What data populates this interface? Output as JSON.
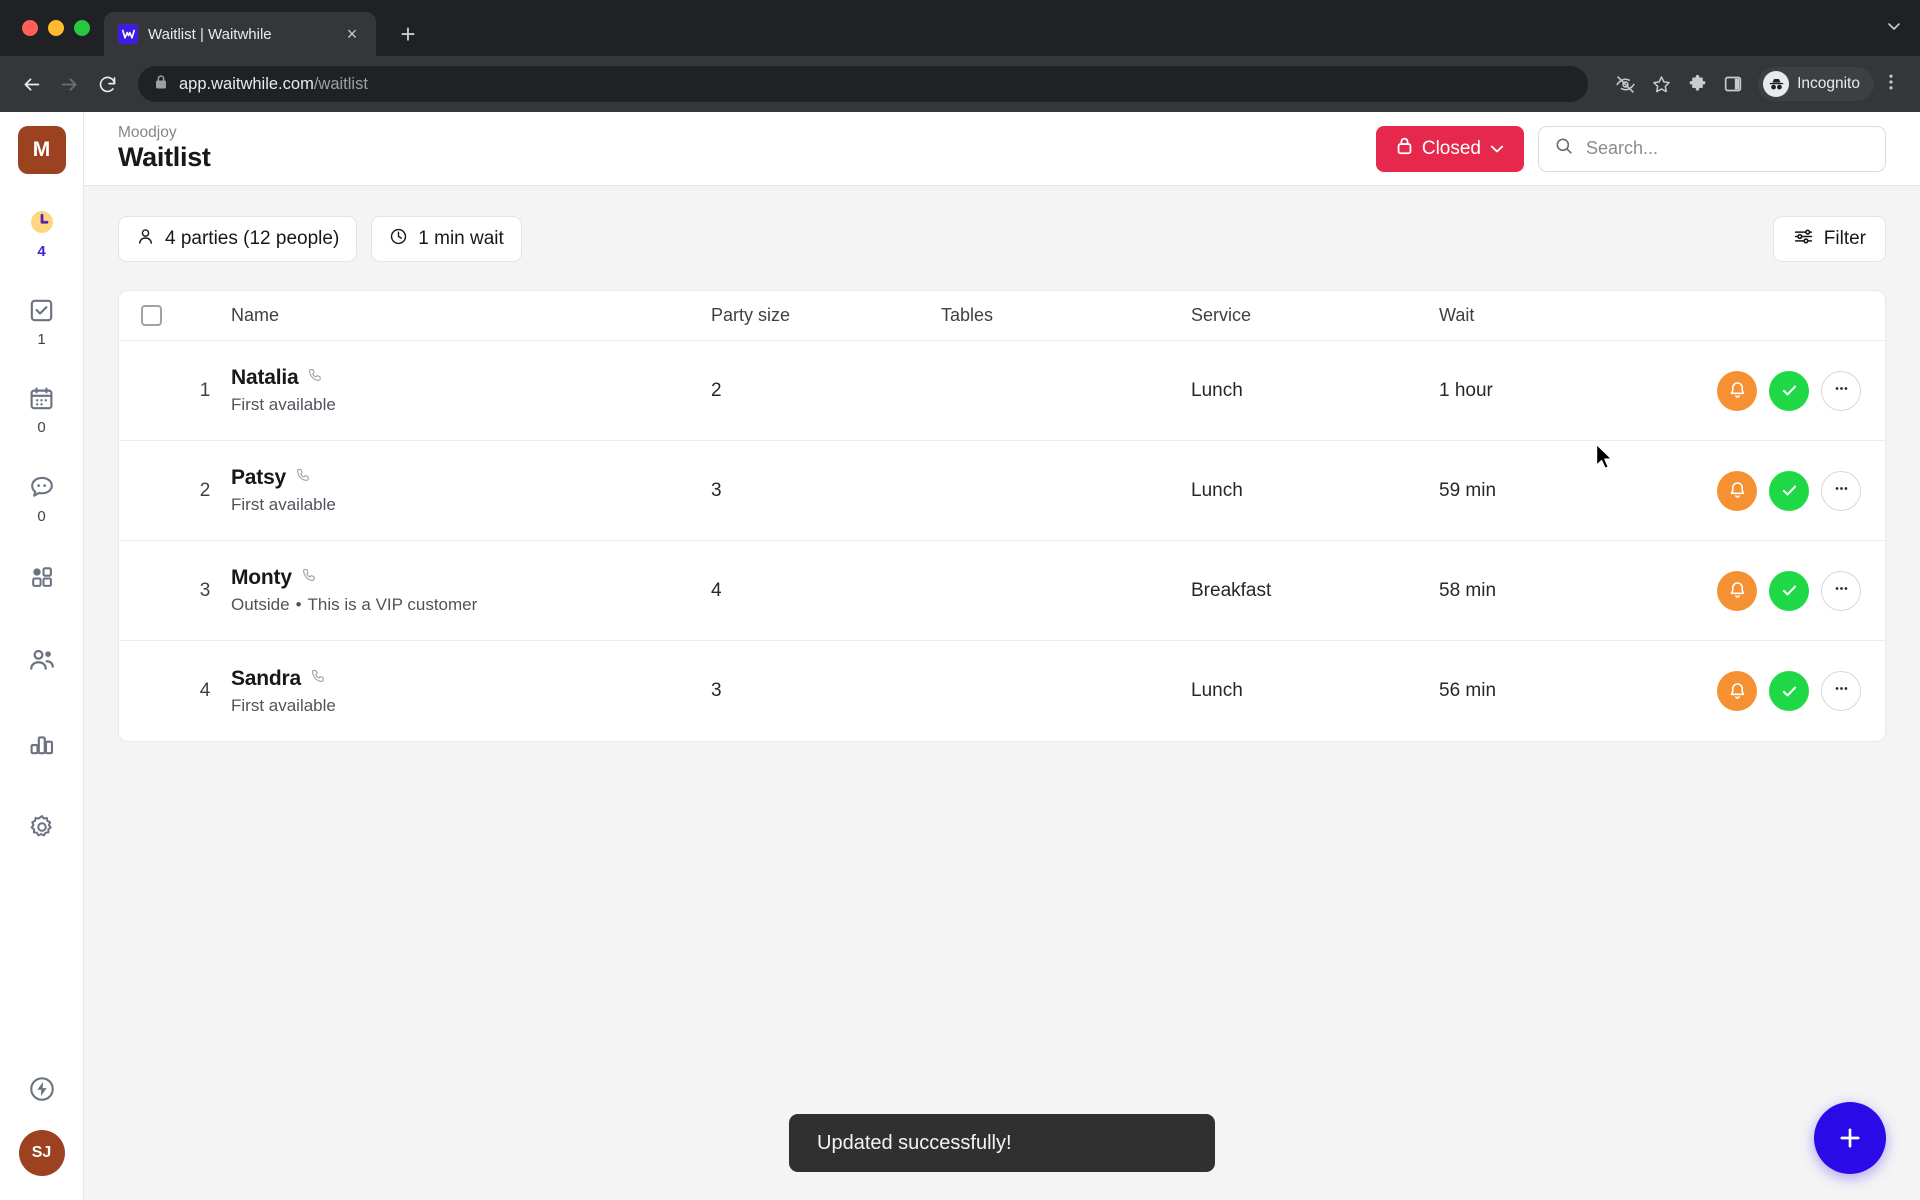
{
  "browser": {
    "tab": {
      "title": "Waitlist | Waitwhile",
      "favicon_letter": "W"
    },
    "new_tab_label": "+",
    "close_label": "×",
    "tab_list_caret": "⌵",
    "url_host": "app.waitwhile.com",
    "url_path": "/waitlist",
    "profile_label": "Incognito",
    "icons": {
      "back": "back-arrow-icon",
      "forward": "forward-arrow-icon",
      "reload": "reload-icon",
      "lock": "lock-icon",
      "tracking_protection": "eye-off-icon",
      "bookmark": "star-icon",
      "extensions": "puzzle-icon",
      "side_panel": "side-panel-icon",
      "menu": "kebab-menu-icon"
    }
  },
  "sidebar": {
    "org_initial": "M",
    "items": [
      {
        "name": "waitlist",
        "icon": "clock-icon",
        "count": "4",
        "active": true
      },
      {
        "name": "serving",
        "icon": "checkbox-icon",
        "count": "1",
        "active": false
      },
      {
        "name": "bookings",
        "icon": "calendar-icon",
        "count": "0",
        "active": false
      },
      {
        "name": "messages",
        "icon": "chat-bubble-icon",
        "count": "0",
        "active": false
      },
      {
        "name": "apps",
        "icon": "grid-icon",
        "count": "",
        "active": false
      },
      {
        "name": "customers",
        "icon": "people-icon",
        "count": "",
        "active": false
      },
      {
        "name": "analytics",
        "icon": "bar-chart-icon",
        "count": "",
        "active": false
      },
      {
        "name": "settings",
        "icon": "gear-icon",
        "count": "",
        "active": false
      }
    ],
    "bottom": {
      "power_icon": "lightning-circle-icon",
      "user_initials": "SJ"
    },
    "accent_color": "#4521d6",
    "brand_color": "#9c4221"
  },
  "header": {
    "org_name": "Moodjoy",
    "title": "Waitlist",
    "status": {
      "label": "Closed",
      "icon": "lock-icon",
      "caret": "⌄",
      "color": "#e5284b"
    },
    "search": {
      "placeholder": "Search...",
      "value": "",
      "icon": "search-icon"
    }
  },
  "toolbar": {
    "parties_chip": {
      "label": "4 parties (12 people)",
      "icon": "person-icon"
    },
    "wait_chip": {
      "label": "1 min wait",
      "icon": "clock-icon"
    },
    "filter_button": {
      "label": "Filter",
      "icon": "filter-sliders-icon"
    }
  },
  "table": {
    "columns": [
      "Name",
      "Party size",
      "Tables",
      "Service",
      "Wait"
    ],
    "rows": [
      {
        "pos": "1",
        "name": "Natalia",
        "contact_icon": "phone-icon",
        "sub": "First available",
        "sub2": "",
        "party_size": "2",
        "tables": "",
        "service": "Lunch",
        "wait": "1 hour"
      },
      {
        "pos": "2",
        "name": "Patsy",
        "contact_icon": "phone-icon",
        "sub": "First available",
        "sub2": "",
        "party_size": "3",
        "tables": "",
        "service": "Lunch",
        "wait": "59 min"
      },
      {
        "pos": "3",
        "name": "Monty",
        "contact_icon": "phone-icon",
        "sub": "Outside",
        "sub2": "This is a VIP customer",
        "party_size": "4",
        "tables": "",
        "service": "Breakfast",
        "wait": "58 min"
      },
      {
        "pos": "4",
        "name": "Sandra",
        "contact_icon": "phone-icon",
        "sub": "First available",
        "sub2": "",
        "party_size": "3",
        "tables": "",
        "service": "Lunch",
        "wait": "56 min"
      }
    ],
    "actions": {
      "notify": {
        "name": "notify-button",
        "icon": "bell-icon",
        "color": "#f59132"
      },
      "done": {
        "name": "mark-served-button",
        "icon": "check-icon",
        "color": "#1ed945"
      },
      "more": {
        "name": "more-actions-button",
        "icon": "ellipsis-icon",
        "label": "•••"
      }
    }
  },
  "toast": {
    "message": "Updated successfully!"
  },
  "fab": {
    "label": "+",
    "name": "add-guest-button",
    "color": "#2b0ae8"
  }
}
